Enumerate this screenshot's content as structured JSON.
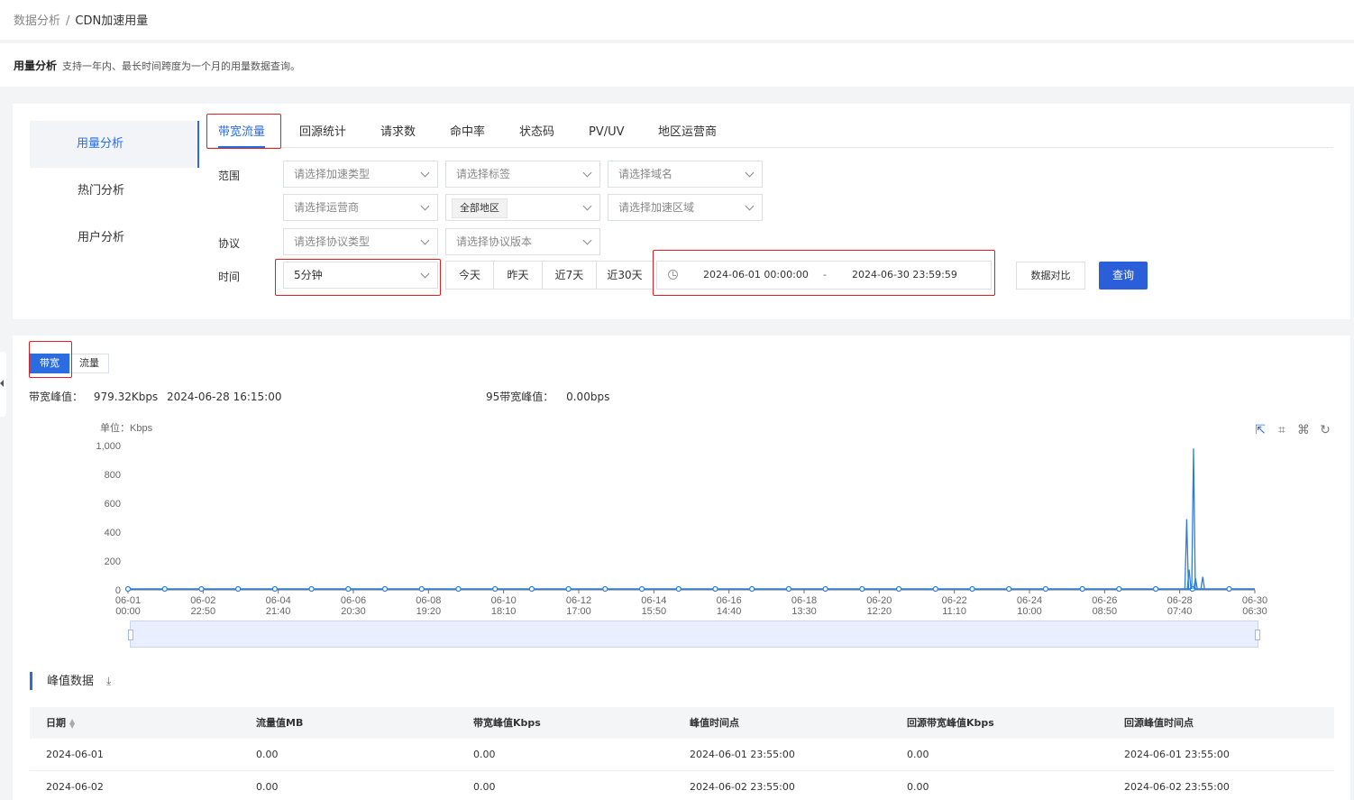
{
  "breadcrumb": {
    "parent": "数据分析",
    "separator": "/",
    "current": "CDN加速用量"
  },
  "header": {
    "title": "用量分析",
    "description": "支持一年内、最长时间跨度为一个月的用量数据查询。"
  },
  "side_nav": {
    "items": [
      "用量分析",
      "热门分析",
      "用户分析"
    ],
    "active": 0
  },
  "tabs": {
    "items": [
      "带宽流量",
      "回源统计",
      "请求数",
      "命中率",
      "状态码",
      "PV/UV",
      "地区运营商"
    ],
    "active": 0
  },
  "filters": {
    "scope_label": "范围",
    "accel_type_placeholder": "请选择加速类型",
    "tag_placeholder": "请选择标签",
    "domain_placeholder": "请选择域名",
    "isp_placeholder": "请选择运营商",
    "region_value": "全部地区",
    "accel_region_placeholder": "请选择加速区域",
    "protocol_label": "协议",
    "protocol_type_placeholder": "请选择协议类型",
    "protocol_version_placeholder": "请选择协议版本",
    "time_label": "时间",
    "granularity_value": "5分钟",
    "quick_ranges": [
      "今天",
      "昨天",
      "近7天",
      "近30天"
    ],
    "date_start": "2024-06-01 00:00:00",
    "date_sep": "-",
    "date_end": "2024-06-30 23:59:59",
    "compare_label": "数据对比",
    "query_label": "查询"
  },
  "metric_toggle": {
    "items": [
      "带宽",
      "流量"
    ],
    "active": 0
  },
  "peak_summary": {
    "peak_label": "带宽峰值：",
    "peak_value": "979.32Kbps",
    "peak_time": "2024-06-28 16:15:00",
    "p95_label": "95带宽峰值：",
    "p95_value": "0.00bps"
  },
  "chart_data": {
    "type": "line",
    "ylabel": "单位：Kbps",
    "ylim": [
      0,
      1000
    ],
    "yticks": [
      "1,000",
      "800",
      "600",
      "400",
      "200",
      "0"
    ],
    "xticks": [
      [
        "06-01",
        "00:00"
      ],
      [
        "06-02",
        "22:50"
      ],
      [
        "06-04",
        "21:40"
      ],
      [
        "06-06",
        "20:30"
      ],
      [
        "06-08",
        "19:20"
      ],
      [
        "06-10",
        "18:10"
      ],
      [
        "06-12",
        "17:00"
      ],
      [
        "06-14",
        "15:50"
      ],
      [
        "06-16",
        "14:40"
      ],
      [
        "06-18",
        "13:30"
      ],
      [
        "06-20",
        "12:20"
      ],
      [
        "06-22",
        "11:10"
      ],
      [
        "06-24",
        "10:00"
      ],
      [
        "06-26",
        "08:50"
      ],
      [
        "06-28",
        "07:40"
      ],
      [
        "06-30",
        "06:30"
      ]
    ],
    "series": [
      {
        "values_desc": "near zero throughout with spikes around 06-28",
        "spikes": [
          {
            "x": "06-28 12:00",
            "y": 490
          },
          {
            "x": "06-28 13:30",
            "y": 140
          },
          {
            "x": "06-28 16:15",
            "y": 979.32
          },
          {
            "x": "06-28 17:30",
            "y": 80
          },
          {
            "x": "06-28 22:00",
            "y": 90
          }
        ]
      }
    ],
    "color": "#2b7fd8",
    "grid": false
  },
  "peak_table": {
    "title": "峰值数据",
    "columns": [
      "日期",
      "流量值MB",
      "带宽峰值Kbps",
      "峰值时间点",
      "回源带宽峰值Kbps",
      "回源峰值时间点"
    ],
    "rows": [
      [
        "2024-06-01",
        "0.00",
        "0.00",
        "2024-06-01 23:55:00",
        "0.00",
        "2024-06-01 23:55:00"
      ],
      [
        "2024-06-02",
        "0.00",
        "0.00",
        "2024-06-02 23:55:00",
        "0.00",
        "2024-06-02 23:55:00"
      ]
    ]
  }
}
